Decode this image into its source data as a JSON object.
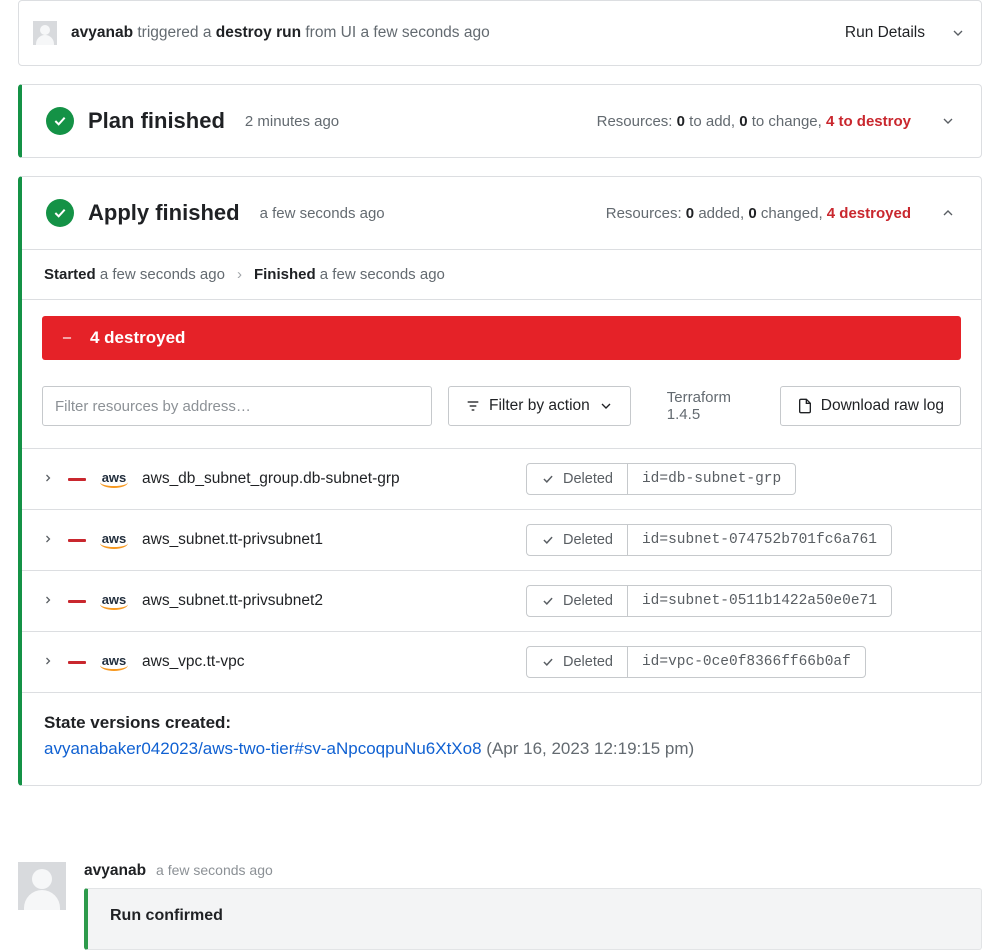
{
  "trigger": {
    "user": "avyanab",
    "verb": "triggered a",
    "action": "destroy run",
    "suffix": "from UI a few seconds ago",
    "details_label": "Run Details"
  },
  "plan": {
    "title": "Plan finished",
    "timestamp": "2 minutes ago",
    "summary_label": "Resources:",
    "to_add": "0",
    "to_add_suffix": "to add,",
    "to_change": "0",
    "to_change_suffix": "to change,",
    "to_destroy": "4 to destroy"
  },
  "apply": {
    "title": "Apply finished",
    "timestamp": "a few seconds ago",
    "summary_label": "Resources:",
    "added": "0",
    "added_suffix": "added,",
    "changed": "0",
    "changed_suffix": "changed,",
    "destroyed": "4 destroyed",
    "started_label": "Started",
    "started_ts": "a few seconds ago",
    "finished_label": "Finished",
    "finished_ts": "a few seconds ago",
    "banner": "4 destroyed"
  },
  "toolbar": {
    "filter_placeholder": "Filter resources by address…",
    "filter_action_label": "Filter by action",
    "tf_version": "Terraform 1.4.5",
    "download_label": "Download raw log"
  },
  "resources": [
    {
      "addr": "aws_db_subnet_group.db-subnet-grp",
      "status": "Deleted",
      "id": "id=db-subnet-grp"
    },
    {
      "addr": "aws_subnet.tt-privsubnet1",
      "status": "Deleted",
      "id": "id=subnet-074752b701fc6a761"
    },
    {
      "addr": "aws_subnet.tt-privsubnet2",
      "status": "Deleted",
      "id": "id=subnet-0511b1422a50e0e71"
    },
    {
      "addr": "aws_vpc.tt-vpc",
      "status": "Deleted",
      "id": "id=vpc-0ce0f8366ff66b0af"
    }
  ],
  "state": {
    "title": "State versions created:",
    "link_text": "avyanabaker042023/aws-two-tier#sv-aNpcoqpuNu6XtXo8",
    "date": "(Apr 16, 2023 12:19:15 pm)"
  },
  "comment": {
    "user": "avyanab",
    "timestamp": "a few seconds ago",
    "text": "Run confirmed"
  }
}
